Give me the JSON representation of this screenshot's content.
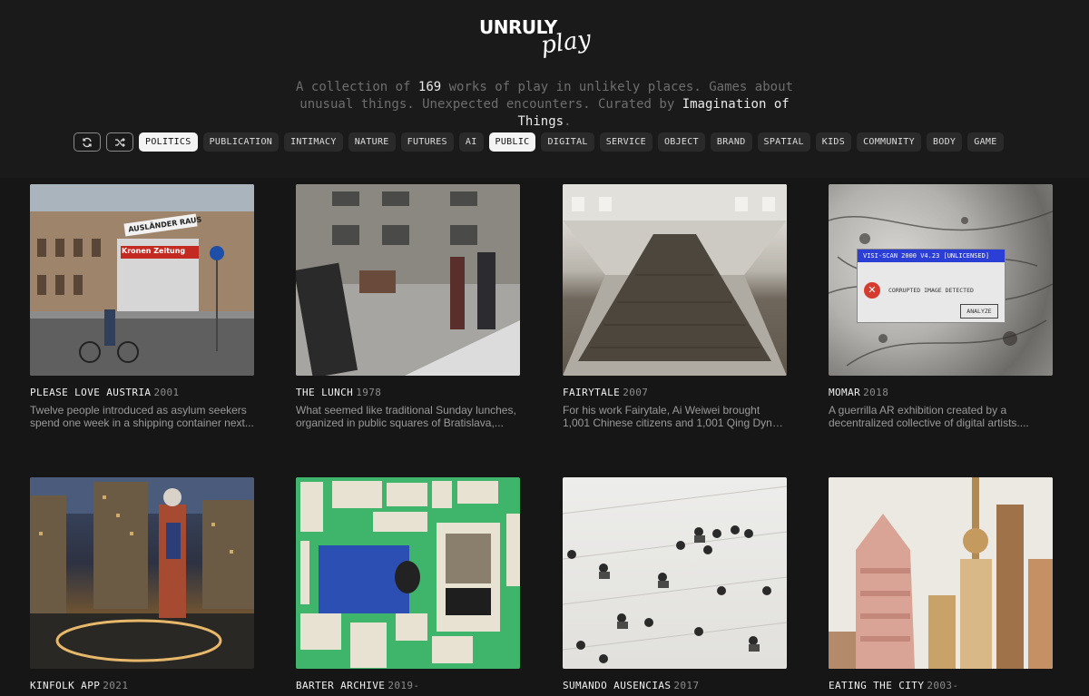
{
  "brand": {
    "logo_main": "UNRULY",
    "logo_script": "play"
  },
  "tagline": {
    "part1": "A collection of ",
    "count": "169",
    "part2": " works of play in unlikely places. Games about unusual things. Unexpected encounters. Curated by ",
    "curator": "Imagination of Things",
    "part3": "."
  },
  "filter_bar": {
    "buttons": [
      {
        "icon": "refresh-icon"
      },
      {
        "icon": "shuffle-icon"
      }
    ],
    "tags": [
      {
        "label": "POLITICS",
        "active": true
      },
      {
        "label": "PUBLICATION",
        "active": false
      },
      {
        "label": "INTIMACY",
        "active": false
      },
      {
        "label": "NATURE",
        "active": false
      },
      {
        "label": "FUTURES",
        "active": false
      },
      {
        "label": "AI",
        "active": false
      },
      {
        "label": "PUBLIC",
        "active": true
      },
      {
        "label": "DIGITAL",
        "active": false
      },
      {
        "label": "SERVICE",
        "active": false
      },
      {
        "label": "OBJECT",
        "active": false
      },
      {
        "label": "BRAND",
        "active": false
      },
      {
        "label": "SPATIAL",
        "active": false
      },
      {
        "label": "KIDS",
        "active": false
      },
      {
        "label": "COMMUNITY",
        "active": false
      },
      {
        "label": "BODY",
        "active": false
      },
      {
        "label": "GAME",
        "active": false
      }
    ]
  },
  "works": [
    {
      "title": "PLEASE LOVE AUSTRIA",
      "year": "2001",
      "desc1": "Twelve people introduced as asylum seekers",
      "desc2": "spend one week in a shipping container next...",
      "image_text1": "AUSLÄNDER RAUS",
      "image_text2": "Kronen Zeitung"
    },
    {
      "title": "THE LUNCH",
      "year": "1978",
      "desc1": "What seemed like traditional Sunday lunches,",
      "desc2": "organized in public squares of Bratislava,..."
    },
    {
      "title": "FAIRYTALE",
      "year": "2007",
      "desc1": "For his work Fairytale, Ai Weiwei brought",
      "desc2": "1,001 Chinese citizens and 1,001 Qing Dynas..."
    },
    {
      "title": "MOMAR",
      "year": "2018",
      "desc1": "A guerrilla AR exhibition created by a",
      "desc2": "decentralized collective of digital artists....",
      "dialog_title": "VISI-SCAN 2000 V4.23 [UNLICENSED]",
      "dialog_msg": "CORRUPTED IMAGE DETECTED",
      "dialog_btn": "ANALYZE"
    },
    {
      "title": "KINFOLK APP",
      "year": "2021",
      "desc1": "",
      "desc2": ""
    },
    {
      "title": "BARTER ARCHIVE",
      "year": "2019-",
      "desc1": "",
      "desc2": ""
    },
    {
      "title": "SUMANDO AUSENCIAS",
      "year": "2017",
      "desc1": "",
      "desc2": ""
    },
    {
      "title": "EATING THE CITY",
      "year": "2003-",
      "desc1": "",
      "desc2": ""
    }
  ]
}
